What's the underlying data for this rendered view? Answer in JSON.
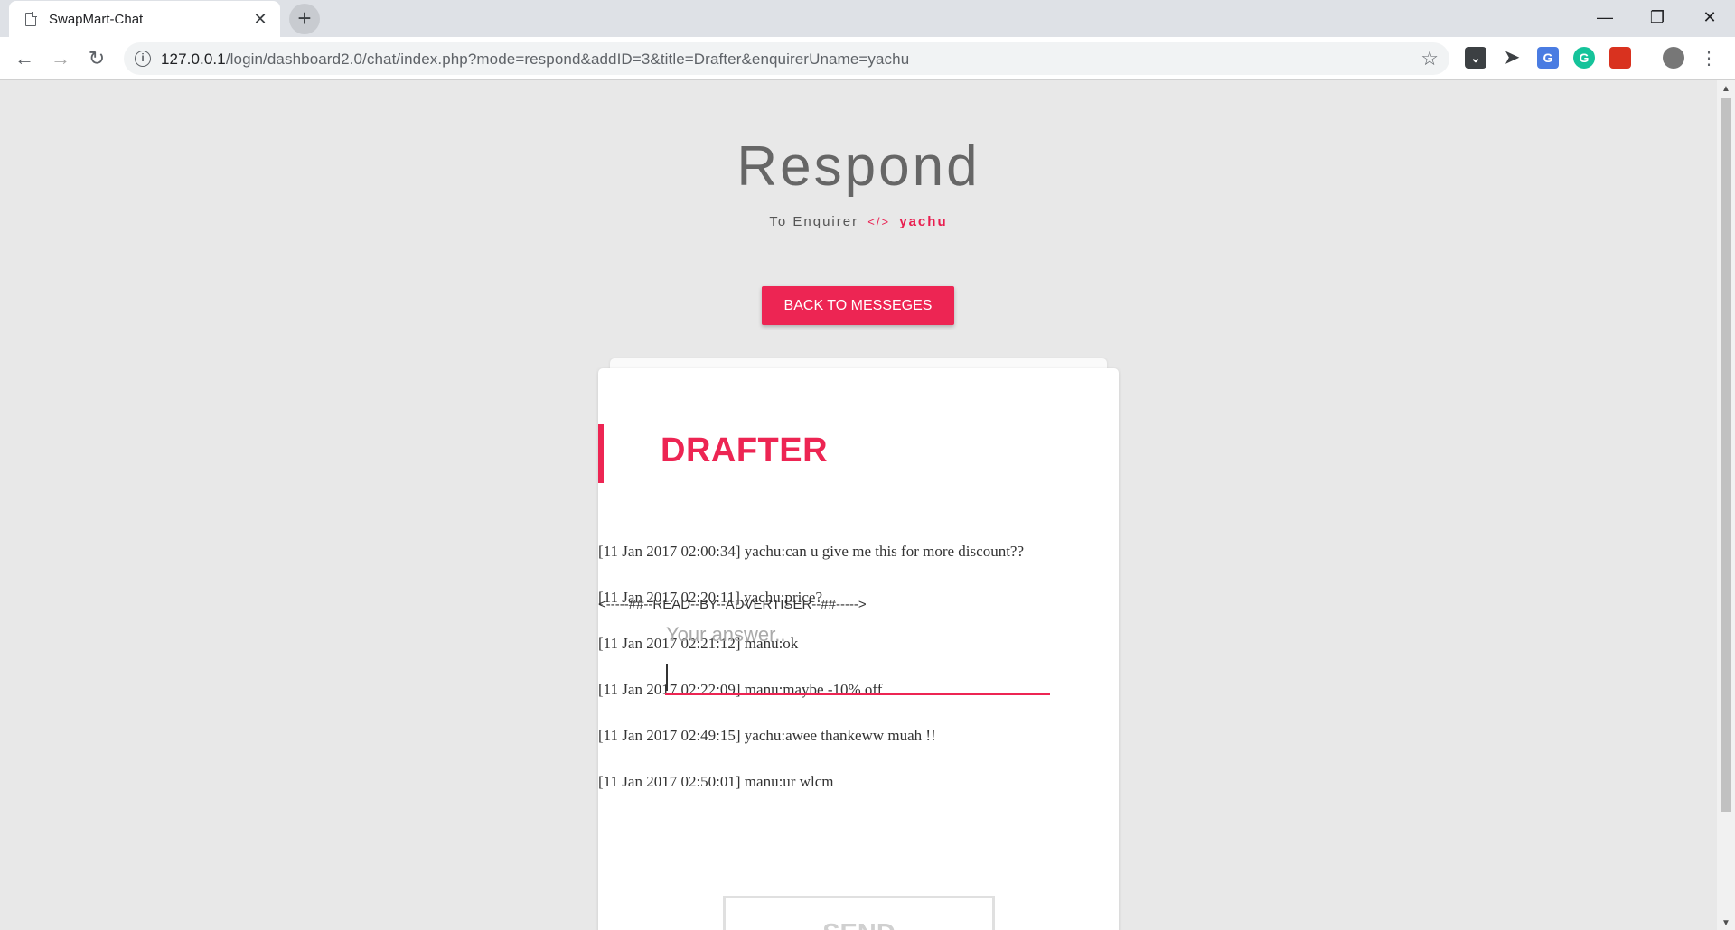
{
  "browser": {
    "tab_title": "SwapMart-Chat",
    "tab_close": "✕",
    "new_tab": "+",
    "url_host": "127.0.0.1",
    "url_path": "/login/dashboard2.0/chat/index.php?mode=respond&addID=3&title=Drafter&enquirerUname=yachu"
  },
  "page": {
    "heading": "Respond",
    "subtitle_prefix": "To Enquirer",
    "subtitle_code": "</>",
    "enquirer": "yachu",
    "back_button": "BACK TO MESSEGES"
  },
  "card": {
    "title": "DRAFTER",
    "messages": [
      "[11 Jan 2017 02:00:34] yachu:can u give me this for more discount??",
      "[11 Jan 2017 02:20:11] yachu:price?",
      "[11 Jan 2017 02:21:12] manu:ok",
      "[11 Jan 2017 02:22:09] manu:maybe -10% off",
      "[11 Jan 2017 02:49:15] yachu:awee thankeww muah !!",
      "[11 Jan 2017 02:50:01] manu:ur wlcm"
    ],
    "read_by": "<-----##--READ--BY--ADVERTISER--##----->",
    "answer_placeholder": "Your answer..",
    "answer_value": "",
    "send_button": "SEND"
  },
  "colors": {
    "accent": "#ed2553",
    "page_bg": "#e8e8e8"
  }
}
